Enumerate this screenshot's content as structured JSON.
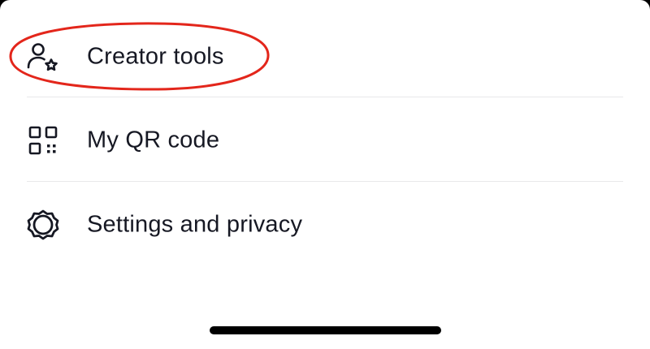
{
  "menu": {
    "items": [
      {
        "label": "Creator tools",
        "icon": "person-star-icon",
        "highlighted": true
      },
      {
        "label": "My QR code",
        "icon": "qr-code-icon",
        "highlighted": false
      },
      {
        "label": "Settings and privacy",
        "icon": "gear-icon",
        "highlighted": false
      }
    ]
  },
  "colors": {
    "text": "#161823",
    "divider": "#e8e8ea",
    "highlight_ring": "#e3261b",
    "background": "#ffffff"
  }
}
